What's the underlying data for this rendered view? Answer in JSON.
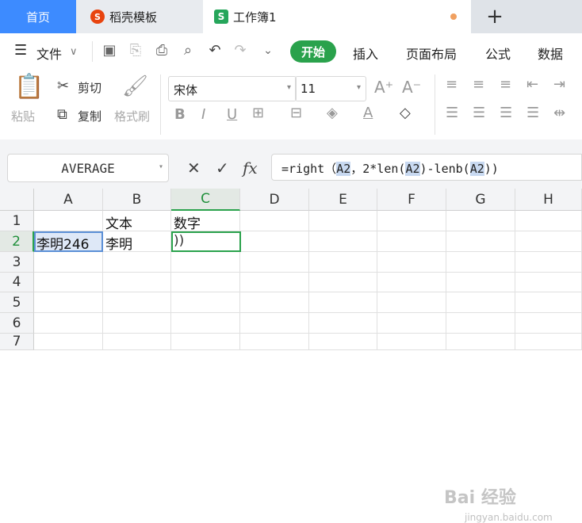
{
  "tabs": {
    "home": "首页",
    "template": "稻壳模板",
    "workbook": "工作簿1",
    "new_tab": "+"
  },
  "menu": {
    "file": "文件",
    "start": "开始",
    "insert": "插入",
    "page_layout": "页面布局",
    "formula": "公式",
    "data": "数据"
  },
  "ribbon": {
    "cut": "剪切",
    "copy": "复制",
    "paste": "粘贴",
    "format_painter": "格式刷",
    "font_name": "宋体",
    "font_size": "11"
  },
  "formula_bar": {
    "name_box": "AVERAGE",
    "fx": "fx",
    "formula_prefix": "=right（",
    "ref1": "A2",
    "mid1": "，2*len(",
    "ref2": "A2",
    "mid2": ")-lenb(",
    "ref3": "A2",
    "suffix": "))"
  },
  "grid": {
    "columns": [
      "A",
      "B",
      "C",
      "D",
      "E",
      "F",
      "G",
      "H"
    ],
    "rows": [
      "1",
      "2",
      "3",
      "4",
      "5",
      "6",
      "7"
    ],
    "cells": {
      "B1": "文本",
      "C1": "数字",
      "A2": "李明246",
      "B2": "李明",
      "C2": "))"
    }
  },
  "watermark": {
    "text": "Bai 经验",
    "url": "jingyan.baidu.com"
  },
  "colors": {
    "accent_green": "#2aa24c",
    "home_tab_blue": "#3d8bff",
    "ref_highlight": "#c8d9f1"
  }
}
